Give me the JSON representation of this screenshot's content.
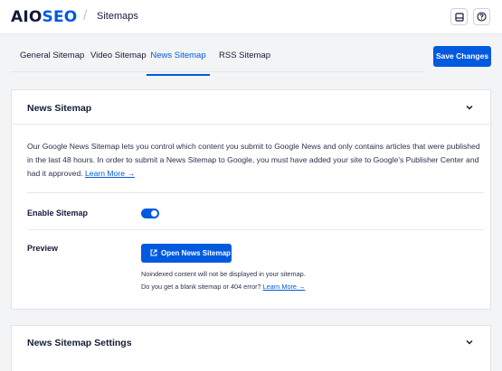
{
  "header": {
    "logo_aio": "AIO",
    "logo_seo": "SEO",
    "breadcrumb": "Sitemaps",
    "icons": [
      "notifications-icon",
      "help-icon"
    ]
  },
  "tabs": [
    {
      "label": "General Sitemap",
      "active": false
    },
    {
      "label": "Video Sitemap",
      "active": false
    },
    {
      "label": "News Sitemap",
      "active": true
    },
    {
      "label": "RSS Sitemap",
      "active": false
    }
  ],
  "save_label": "Save Changes",
  "news_card": {
    "title": "News Sitemap",
    "description": "Our Google News Sitemap lets you control which content you submit to Google News and only contains articles that were published in the last 48 hours. In order to submit a News Sitemap to Google, you must have added your site to Google's Publisher Center and had it approved.",
    "learn_more": "Learn More →",
    "enable_label": "Enable Sitemap",
    "enabled": true,
    "preview_label": "Preview",
    "open_button": "Open News Sitemap",
    "note1": "Noindexed content will not be displayed in your sitemap.",
    "note2": "Do you get a blank sitemap or 404 error?",
    "note2_link": "Learn More →"
  },
  "settings_card": {
    "title": "News Sitemap Settings"
  },
  "colors": {
    "accent": "#005ae0",
    "text": "#141b38",
    "background": "#f3f4f5"
  }
}
